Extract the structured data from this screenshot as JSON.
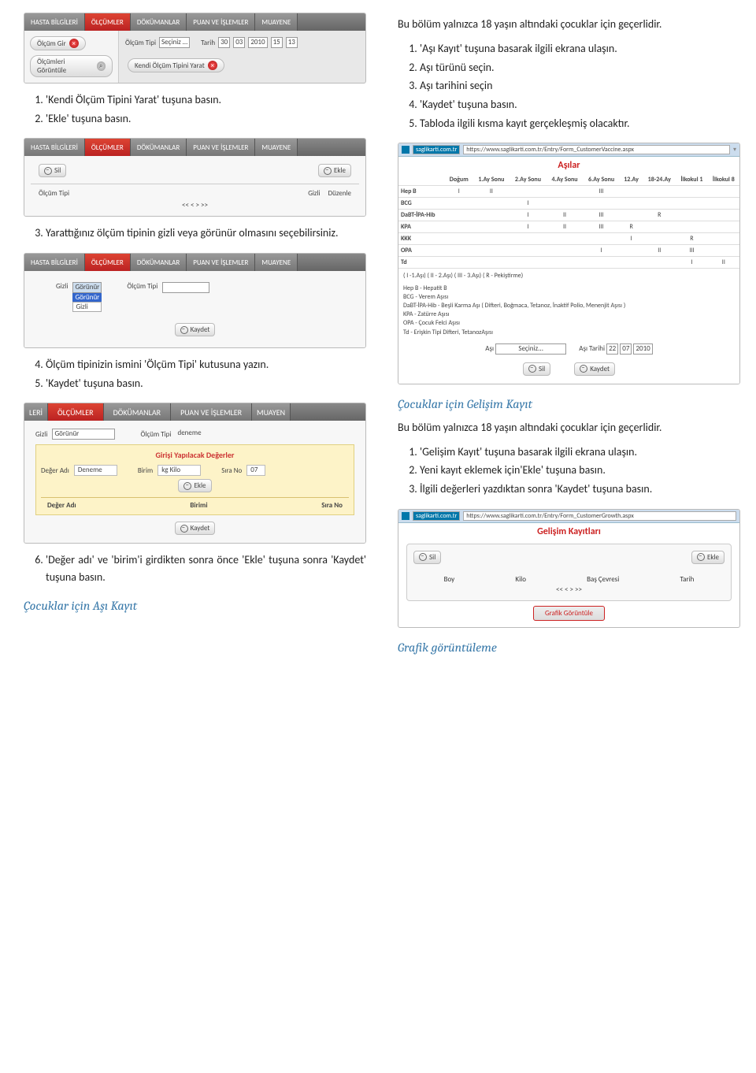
{
  "screens": {
    "olcum1": {
      "tabs": [
        "HASTA BİLGİLERİ",
        "ÖLÇÜMLER",
        "DÖKÜMANLAR",
        "PUAN VE İŞLEMLER",
        "MUAYENE"
      ],
      "active_idx": 1,
      "side_buttons": [
        "Ölçüm Gir",
        "Ölçümleri Görüntüle"
      ],
      "lbl_olcum_tipi": "Ölçüm Tipi",
      "sel_olcum": "Seçiniz …",
      "lbl_tarih": "Tarih",
      "date_parts": [
        "30",
        "03",
        "2010",
        "15",
        "13"
      ],
      "btn_kendi": "Kendi Ölçüm Tipini Yarat"
    },
    "olcum2": {
      "tabs": [
        "HASTA BİLGİLERİ",
        "ÖLÇÜMLER",
        "DÖKÜMANLAR",
        "PUAN VE İŞLEMLER",
        "MUAYENE"
      ],
      "active_idx": 1,
      "btn_sil": "Sil",
      "btn_ekle": "Ekle",
      "lbl_olcum_tipi": "Ölçüm Tipi",
      "lbl_gizli": "Gizli",
      "lbl_duzenle": "Düzenle",
      "pager": "<< < > >>"
    },
    "olcum3": {
      "tabs": [
        "HASTA BİLGİLERİ",
        "ÖLÇÜMLER",
        "DÖKÜMANLAR",
        "PUAN VE İŞLEMLER",
        "MUAYENE"
      ],
      "active_idx": 1,
      "lbl_gizli": "Gizli",
      "sel_gorunur": "Görünür",
      "opt2": "Görünür",
      "opt3": "Gizli",
      "lbl_olcum_tipi": "Ölçüm Tipi",
      "btn_kaydet": "Kaydet"
    },
    "olcum4": {
      "tabs": [
        "LERİ",
        "ÖLÇÜMLER",
        "DÖKÜMANLAR",
        "PUAN VE İŞLEMLER",
        "MUAYEN"
      ],
      "active_idx": 1,
      "lbl_gizli": "Gizli",
      "val_gorunur": "Görünür",
      "lbl_olcum_tipi": "Ölçüm Tipi",
      "val_olcum_tipi": "deneme",
      "yellow_title": "Girişi Yapılacak Değerler",
      "lbl_deger": "Değer Adı",
      "val_deger": "Deneme",
      "lbl_birim": "Birim",
      "val_birim": "kg Kilo",
      "lbl_sira": "Sıra No",
      "val_sira": "07",
      "btn_ekle": "Ekle",
      "h_deger": "Değer Adı",
      "h_birim": "Birimi",
      "h_sira": "Sıra No",
      "btn_kaydet": "Kaydet"
    },
    "asilar": {
      "url_host": "saglikarti.com.tr",
      "url": "https://www.saglikarti.com.tr/Entry/Form_CustomerVaccine.aspx",
      "title": "Aşılar",
      "cols": [
        "",
        "Doğum",
        "1.Ay Sonu",
        "2.Ay Sonu",
        "4.Ay Sonu",
        "6.Ay Sonu",
        "12.Ay",
        "18-24.Ay",
        "İlkokul 1",
        "İlkokul 8"
      ],
      "rows": [
        {
          "n": "Hep B",
          "c": [
            "I",
            "II",
            "",
            "",
            "III",
            "",
            "",
            "",
            ""
          ]
        },
        {
          "n": "BCG",
          "c": [
            "",
            "",
            "I",
            "",
            "",
            "",
            "",
            "",
            ""
          ]
        },
        {
          "n": "DaBT-İPA-Hib",
          "c": [
            "",
            "",
            "I",
            "II",
            "III",
            "",
            "R",
            "",
            ""
          ]
        },
        {
          "n": "KPA",
          "c": [
            "",
            "",
            "I",
            "II",
            "III",
            "R",
            "",
            "",
            ""
          ]
        },
        {
          "n": "KKK",
          "c": [
            "",
            "",
            "",
            "",
            "",
            "I",
            "",
            "R",
            ""
          ]
        },
        {
          "n": "OPA",
          "c": [
            "",
            "",
            "",
            "",
            "I",
            "",
            "II",
            "III",
            ""
          ]
        },
        {
          "n": "Td",
          "c": [
            "",
            "",
            "",
            "",
            "",
            "",
            "",
            "I",
            "II"
          ]
        }
      ],
      "legend_title": "( I -1.Aşı) ( II - 2.Aşı) ( III - 3.Aşı) ( R - Pekiştirme)",
      "defs": [
        "Hep B - Hepatit B",
        "BCG - Verem Aşısı",
        "DaBT-İPA-Hib - Beşli Karma Aşı ( Difteri, Boğmaca, Tetanoz, İnaktif Polio, Menenjit Aşısı )",
        "KPA - Zatürre Aşısı",
        "OPA - Çocuk Felci Aşısı",
        "Td - Erişkin Tipi Difteri, TetanozAşısı"
      ],
      "lbl_asi": "Aşı",
      "val_asi": "Seçiniz...",
      "lbl_tarih": "Aşı Tarihi",
      "date_parts": [
        "22",
        "07",
        "2010"
      ],
      "btn_sil": "Sil",
      "btn_kaydet": "Kaydet"
    },
    "gelisim": {
      "url_host": "saglikarti.com.tr",
      "url": "https://www.saglikarti.com.tr/Entry/Form_CustomerGrowth.aspx",
      "title": "Gelişim Kayıtları",
      "btn_sil": "Sil",
      "btn_ekle": "Ekle",
      "cols": [
        "Boy",
        "Kilo",
        "Baş Çevresi",
        "Tarih"
      ],
      "pager": "<< < > >>",
      "btn_grafik": "Grafik Görüntüle"
    }
  },
  "text": {
    "intro_right": "Bu bölüm yalnızca 18 yaşın altındaki çocuklar için geçerlidir.",
    "list_right_asi": [
      "'Aşı Kayıt' tuşuna basarak ilgili ekrana ulaşın.",
      "Aşı türünü seçin.",
      "Aşı tarihini seçin",
      "'Kaydet' tuşuna basın.",
      "Tabloda ilgili kısma kayıt gerçekleşmiş olacaktır."
    ],
    "left_after_s1": [
      "'Kendi Ölçüm Tipini Yarat' tuşuna basın.",
      "'Ekle' tuşuna basın."
    ],
    "step3_left": "Yarattığınız ölçüm tipinin gizli veya görünür olmasını seçebilirsiniz.",
    "left_after_s3": [
      "Ölçüm tipinizin ismini 'Ölçüm Tipi' kutusuna yazın.",
      "'Kaydet' tuşuna basın."
    ],
    "step6_left": "'Değer adı' ve 'birim'i girdikten sonra önce 'Ekle' tuşuna sonra 'Kaydet' tuşuna basın.",
    "heading_cocuk_asi": "Çocuklar için Aşı Kayıt",
    "heading_cocuk_gelisim": "Çocuklar için Gelişim Kayıt",
    "intro_gelisim": "Bu bölüm yalnızca 18 yaşın altındaki çocuklar için geçerlidir.",
    "list_gelisim": [
      "'Gelişim Kayıt' tuşuna basarak ilgili ekrana ulaşın.",
      "Yeni kayıt eklemek için'Ekle' tuşuna basın.",
      "İlgili değerleri yazdıktan sonra 'Kaydet' tuşuna basın."
    ],
    "heading_grafik": "Grafik görüntüleme"
  }
}
